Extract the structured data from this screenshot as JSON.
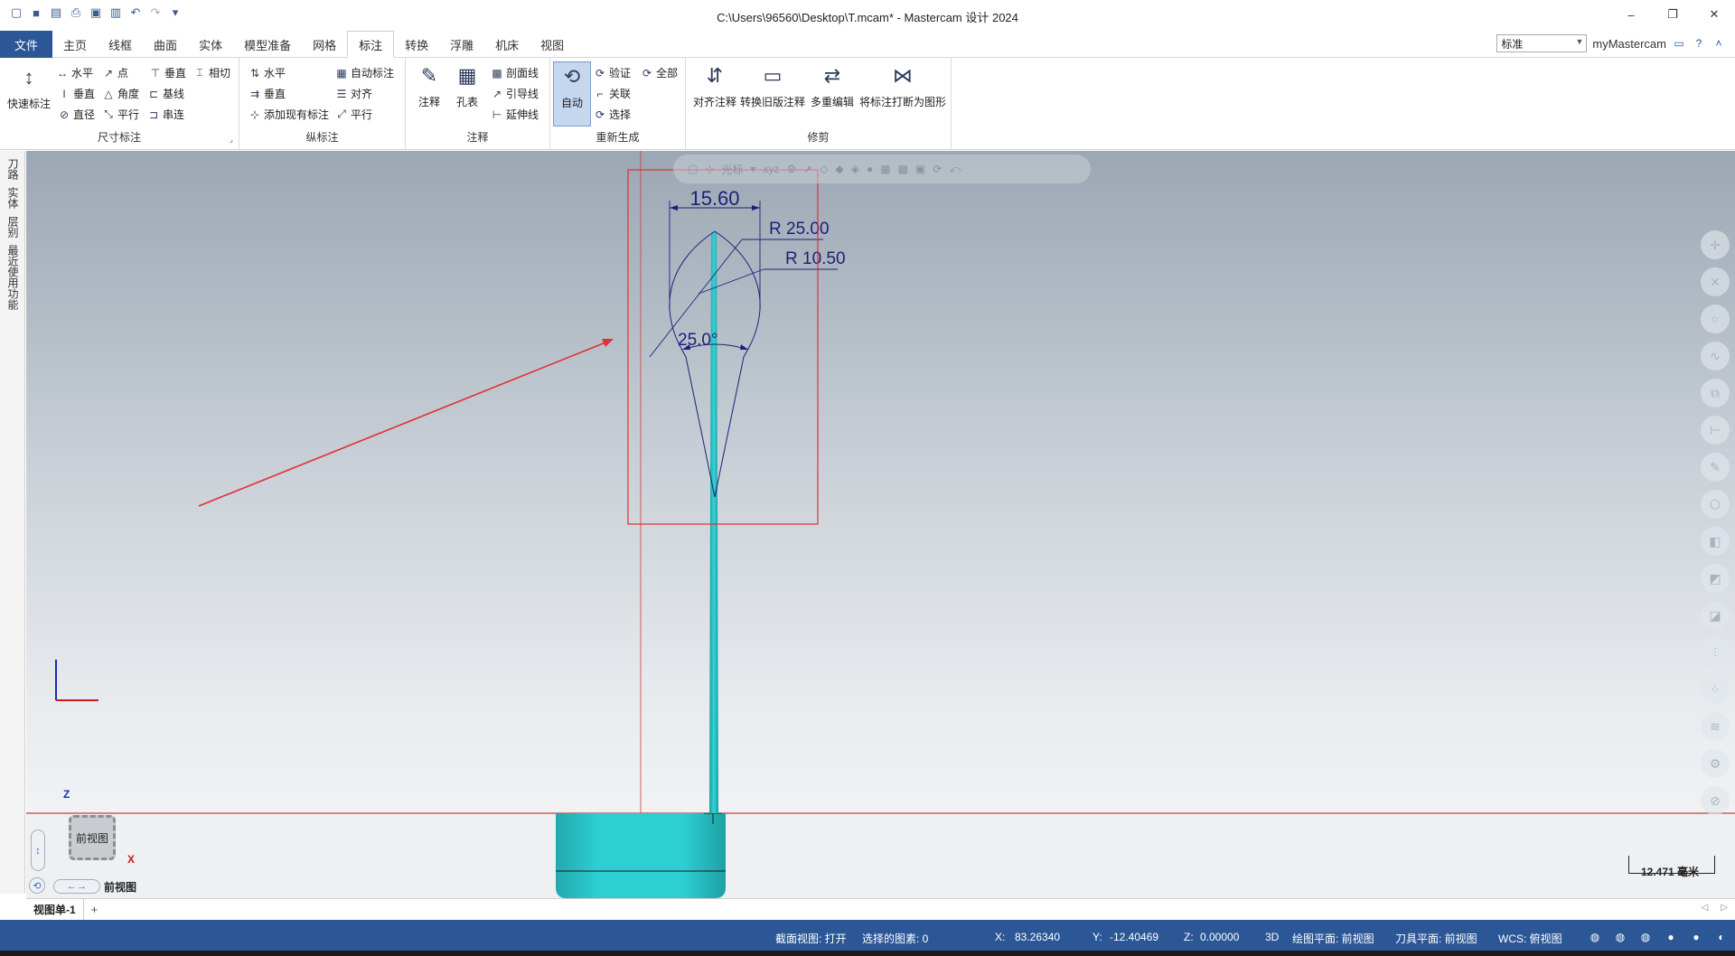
{
  "window": {
    "title": "C:\\Users\\96560\\Desktop\\T.mcam* - Mastercam 设计 2024"
  },
  "quick_access": [
    "new-icon",
    "save-icon",
    "open-icon",
    "print-icon",
    "save-as-icon",
    "merge-icon",
    "undo-icon",
    "redo-icon",
    "customize-icon"
  ],
  "menu": {
    "file": "文件",
    "tabs": [
      "主页",
      "线框",
      "曲面",
      "实体",
      "模型准备",
      "网格",
      "标注",
      "转换",
      "浮雕",
      "机床",
      "视图"
    ],
    "active_tab": "标注",
    "style_select": "标准",
    "my_mastercam": "myMastercam"
  },
  "ribbon": {
    "dimension": {
      "label": "尺寸标注",
      "quick": "快速标注",
      "h": "水平",
      "pt": "点",
      "vert": "垂直",
      "tan": "相切",
      "vert2": "垂直",
      "angle": "角度",
      "baseline": "基线",
      "dia": "直径",
      "parallel": "平行",
      "chain": "串连"
    },
    "ordinate": {
      "label": "纵标注",
      "h": "水平",
      "auto": "自动标注",
      "v": "垂直",
      "align": "对齐",
      "add": "添加现有标注",
      "parallel": "平行"
    },
    "note": {
      "label": "注释",
      "note": "注释",
      "hole": "孔表",
      "hatch": "剖面线",
      "leader": "引导线",
      "ext": "延伸线"
    },
    "regen": {
      "label": "重新生成",
      "auto": "自动",
      "verify": "验证",
      "all": "全部",
      "assoc": "关联",
      "select": "选择"
    },
    "trim": {
      "label": "修剪",
      "align": "对齐注释",
      "convert": "转换旧版注释",
      "multi": "多重编辑",
      "explode": "将标注打断为图形"
    }
  },
  "side_panel": [
    "刀路",
    "实体",
    "层别",
    "最近使用功能"
  ],
  "floating_toolbar": {
    "cursor": "光标",
    "xyz": "xyz"
  },
  "drawing": {
    "dim_width": "15.60",
    "radius_large": "R 25.00",
    "radius_small": "R 10.50",
    "angle": "25.0°"
  },
  "view": {
    "name": "前视图",
    "cube_label": "前视图",
    "axis_z": "Z",
    "axis_x": "X",
    "scale": "12.471 毫米"
  },
  "sheets": {
    "active": "视图单-1",
    "add": "+"
  },
  "status": {
    "section": "截面视图: 打开",
    "selected": "选择的图素: 0",
    "x_label": "X:",
    "x": "83.26340",
    "y_label": "Y:",
    "y": "-12.40469",
    "z_label": "Z:",
    "z": "0.00000",
    "mode": "3D",
    "cplane": "绘图平面: 前视图",
    "tplane": "刀具平面: 前视图",
    "wcs": "WCS: 俯视图"
  },
  "colors": {
    "accent": "#2b5797",
    "part": "#2fc6c9",
    "annotation": "#1c1f7a",
    "highlight_box": "#e0303a"
  }
}
